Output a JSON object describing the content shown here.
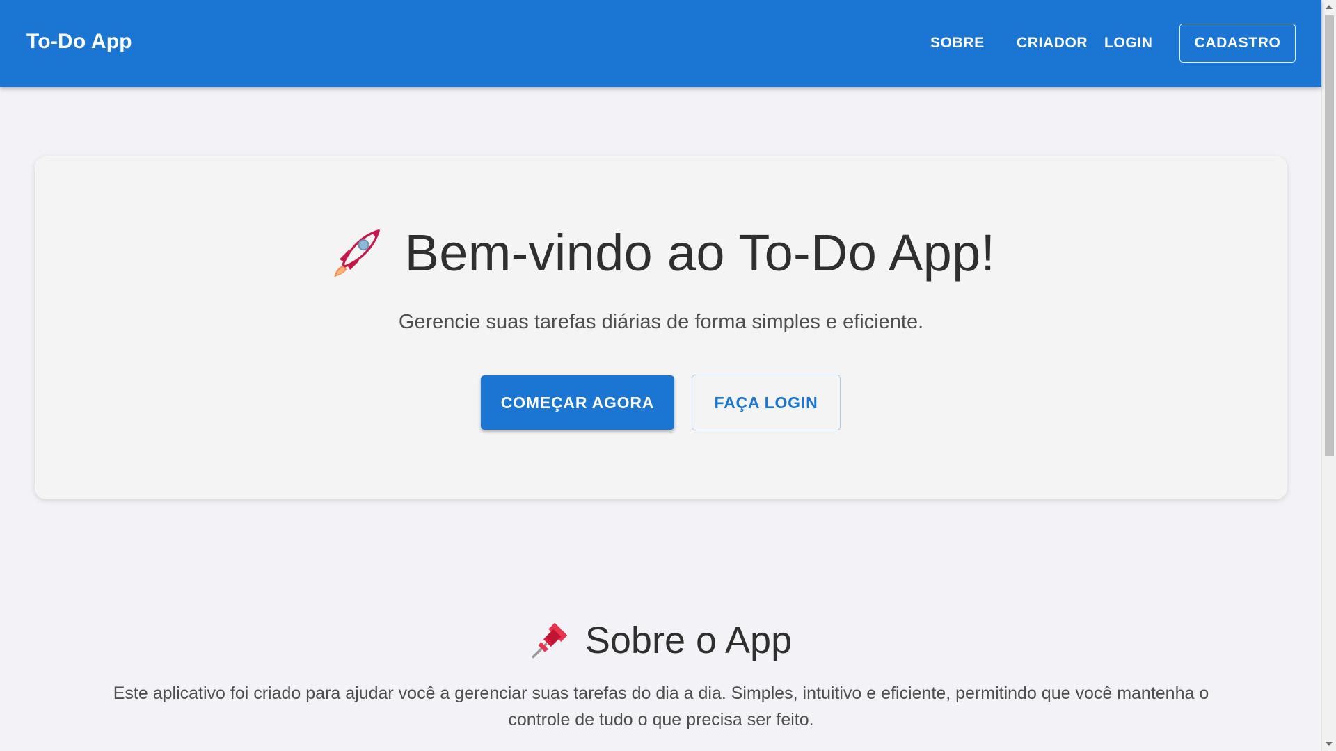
{
  "appbar": {
    "brand": "To-Do App",
    "nav": {
      "sobre": "SOBRE",
      "criador": "CRIADOR",
      "login": "LOGIN",
      "cadastro": "CADASTRO"
    },
    "color": "#1a76d2"
  },
  "hero": {
    "icon": "rocket-icon",
    "title": "Bem-vindo ao To-Do App!",
    "subtitle": "Gerencie suas tarefas diárias de forma simples e eficiente.",
    "primary_button": "COMEÇAR AGORA",
    "secondary_button": "FAÇA LOGIN"
  },
  "about": {
    "icon": "pushpin-icon",
    "title": "Sobre o App",
    "text": "Este aplicativo foi criado para ajudar você a gerenciar suas tarefas do dia a dia. Simples, intuitivo e eficiente, permitindo que você mantenha o controle de tudo o que precisa ser feito."
  },
  "colors": {
    "primary": "#1a76d2",
    "background": "#f3f2f6",
    "card": "#f4f4f4",
    "text_dark": "#2f2f2f",
    "text_muted": "#4e4e4e"
  }
}
